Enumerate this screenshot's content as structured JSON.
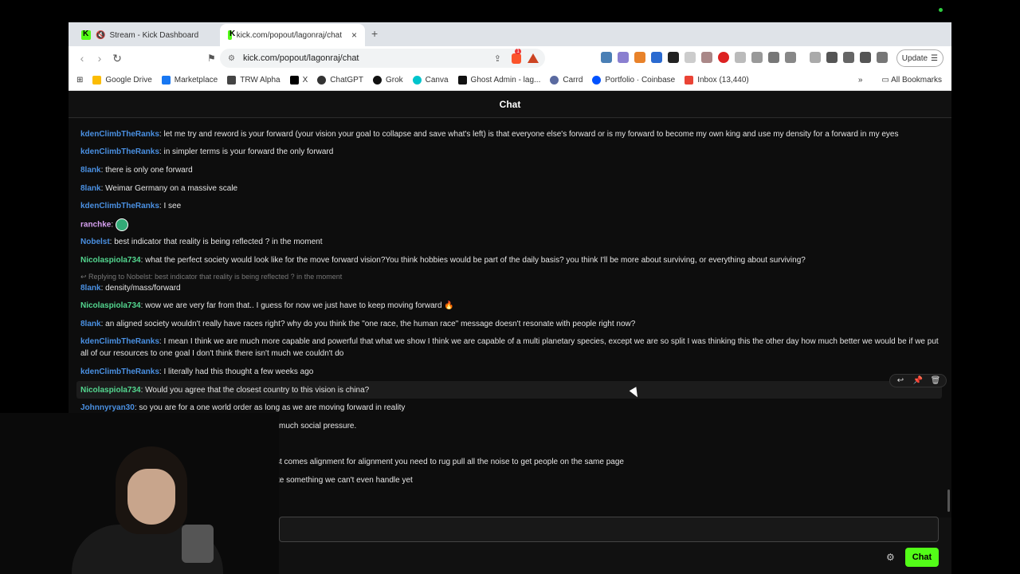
{
  "browser": {
    "tabs": [
      {
        "label": "Stream - Kick Dashboard",
        "active": false
      },
      {
        "label": "kick.com/popout/lagonraj/chat",
        "active": true
      }
    ],
    "url": "kick.com/popout/lagonraj/chat",
    "update_label": "Update",
    "bookmarks": [
      "Google Drive",
      "Marketplace",
      "TRW Alpha",
      "X",
      "ChatGPT",
      "Grok",
      "Canva",
      "Ghost Admin - lag...",
      "Carrd",
      "Portfolio · Coinbase",
      "Inbox (13,440)"
    ],
    "all_bookmarks_label": "All Bookmarks",
    "notification_badge": "1"
  },
  "chat": {
    "title": "Chat",
    "send_label": "Chat",
    "messages": [
      {
        "user": "kdenClimbTheRanks",
        "text": ": let me try and reword is your forward (your vision your goal to collapse and save what's left) is that everyone else's forward or is my forward to become my own king and use my density for a forward in my eyes"
      },
      {
        "user": "kdenClimbTheRanks",
        "text": ": in simpler terms is your forward the only forward"
      },
      {
        "user": "8lank",
        "text": ": there is only one forward"
      },
      {
        "user": "8lank",
        "text": ": Weimar Germany on a massive scale"
      },
      {
        "user": "kdenClimbTheRanks",
        "text": ": I see"
      },
      {
        "user": "ranchke",
        "text": ":"
      },
      {
        "user": "Nobelst",
        "text": ": best indicator that reality is being reflected ? in the moment"
      },
      {
        "user": "Nicolaspiola734",
        "text": ": what the perfect society would look like for the move forward vision?You think hobbies would be part of the daily basis? you think I'll be more about surviving, or everything about surviving?"
      },
      {
        "reply": "↩ Replying to Nobelst: best indicator that reality is being reflected ? in the moment"
      },
      {
        "user": "8lank",
        "text": ": density/mass/forward"
      },
      {
        "user": "Nicolaspiola734",
        "text": ": wow we are very far from that.. I guess for now we just have to keep moving forward 🔥"
      },
      {
        "user": "8lank",
        "text": ": an aligned society wouldn't really have races right? why do you think the \"one race, the human race\" message doesn't resonate with people right now?"
      },
      {
        "user": "kdenClimbTheRanks",
        "text": ": I mean I think we are much more capable and powerful that what we show I think we are capable of a multi planetary species, except we are so split I was thinking this the other day how much better we would be if we put all of our resources to one goal I don't think there isn't much we couldn't do"
      },
      {
        "user": "kdenClimbTheRanks",
        "text": ": I literally had this thought a few weeks ago"
      },
      {
        "user": "Nicolaspiola734",
        "text": ": Would you agree that the closest country to this vision is china?"
      },
      {
        "user": "Johnnyryan30",
        "text": ": so you are for a one world order as long as we are moving forward in reality"
      },
      {
        "text": "much social pressure."
      },
      {
        "text": "st comes alignment for alignment you need to rug pull all the noise to get people on the same page"
      },
      {
        "text": "te something we can't even handle yet"
      }
    ]
  },
  "colors": {
    "kick_green": "#53fc18",
    "username_blue": "#4a90e2",
    "username_green": "#53d68f"
  }
}
